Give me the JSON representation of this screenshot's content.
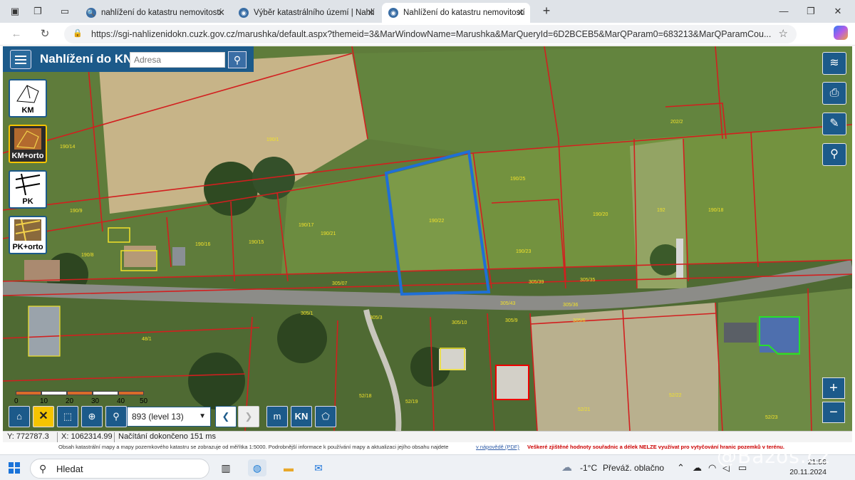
{
  "browser": {
    "tabs": [
      {
        "title": "nahlížení do katastru nemovitostí",
        "active": false
      },
      {
        "title": "Výběr katastrálního území | Nahlí",
        "active": false
      },
      {
        "title": "Nahlížení do katastru nemovitostí",
        "active": true
      }
    ],
    "url": "https://sgi-nahlizenidokn.cuzk.gov.cz/marushka/default.aspx?themeid=3&MarWindowName=Marushka&MarQueryId=6D2BCEB5&MarQParam0=683213&MarQParamCou..."
  },
  "app": {
    "title": "Nahlížení do KN",
    "search_placeholder": "Adresa"
  },
  "layers": [
    {
      "label": "KM",
      "active": false
    },
    {
      "label": "KM+orto",
      "active": true
    },
    {
      "label": "PK",
      "active": false
    },
    {
      "label": "PK+orto",
      "active": false
    }
  ],
  "parcels": [
    "190/1",
    "190/14",
    "190/9",
    "190/8",
    "190/16",
    "190/15",
    "190/17",
    "190/21",
    "190/22",
    "190/25",
    "190/23",
    "190/20",
    "192",
    "190/18",
    "202/2",
    "305/07",
    "305/1",
    "305/39",
    "305/35",
    "305/36",
    "305/43",
    "305/3",
    "305/6",
    "305/10",
    "305/9",
    "48/1",
    "52/22",
    "52/21",
    "52/23",
    "52/18",
    "52/19"
  ],
  "scale": {
    "labels": [
      "0",
      "10",
      "20",
      "30",
      "40",
      "50 m"
    ],
    "colors": [
      "#d96b2a",
      "#ffffff",
      "#d96b2a",
      "#ffffff",
      "#d96b2a"
    ]
  },
  "toolbar": {
    "level": "893 (level 13)",
    "m_label": "m",
    "kn_label": "KN"
  },
  "status": {
    "y": "Y: 772787.3",
    "x": "X: 1062314.99",
    "load": "Načítání dokončeno 151 ms"
  },
  "disclaimer": {
    "text1": "Obsah katastrální mapy a mapy pozemkového katastru se zobrazuje od měřítka 1:5000. Podrobnější informace k používání mapy a aktualizaci jejího obsahu najdete",
    "link": "v nápovědě (PDF)",
    "warning": "Veškeré zjištěné hodnoty souřadnic a délek NELZE využívat pro vytyčování hranic pozemků v terénu."
  },
  "taskbar": {
    "search": "Hledat",
    "weather_temp": "-1°C",
    "weather_text": "Převáž. oblačno",
    "time": "21:56",
    "date": "20.11.2024",
    "watermark": "@Bazos.cz"
  }
}
